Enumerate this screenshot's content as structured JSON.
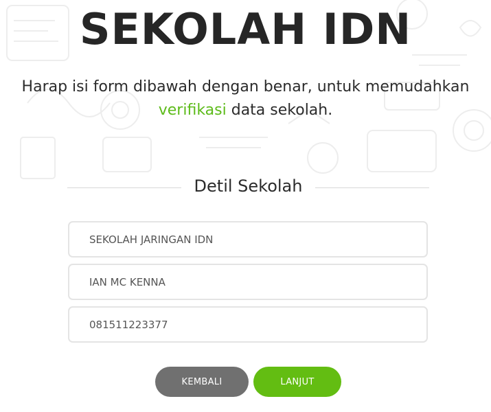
{
  "header": {
    "title": "SEKOLAH IDN",
    "subtitle_before": "Harap isi form dibawah dengan benar, untuk memudahkan",
    "subtitle_accent": "verifikasi",
    "subtitle_after": "data sekolah."
  },
  "section": {
    "title": "Detil Sekolah"
  },
  "form": {
    "school_name": "SEKOLAH JARINGAN IDN",
    "contact_name": "IAN MC KENNA",
    "phone": "081511223377"
  },
  "actions": {
    "back_label": "KEMBALI",
    "next_label": "LANJUT"
  },
  "colors": {
    "accent": "#5dbb1a",
    "next_button": "#63bd12",
    "back_button": "#707070"
  }
}
